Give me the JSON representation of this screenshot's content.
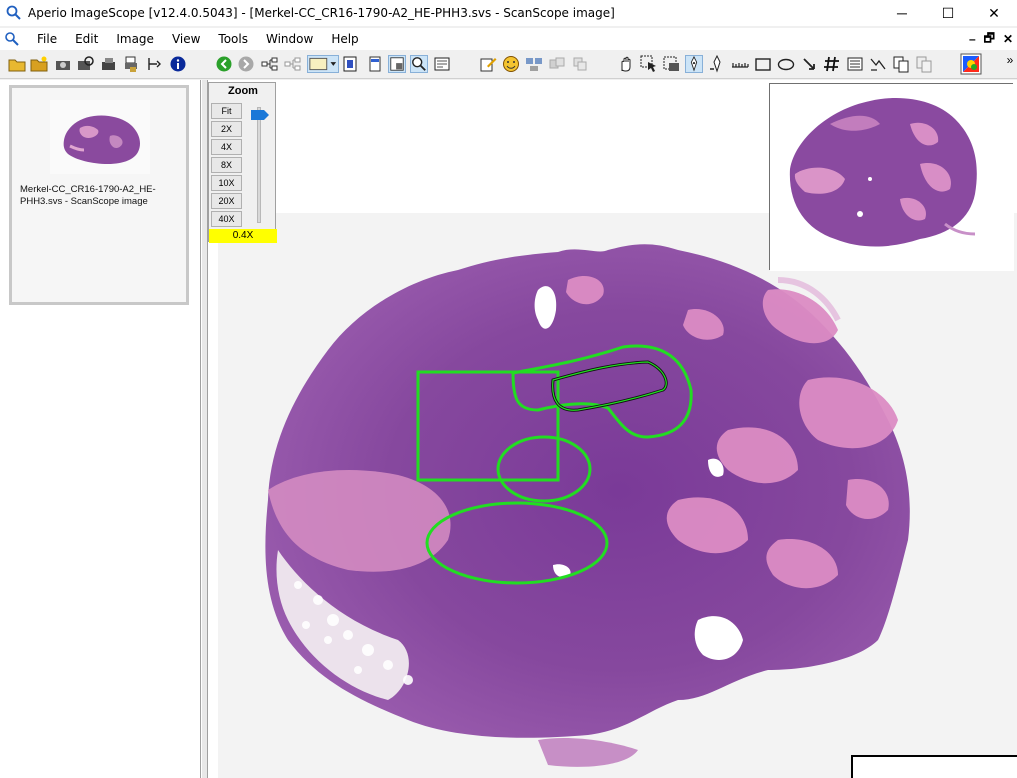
{
  "window": {
    "title": "Aperio ImageScope [v12.4.0.5043] - [Merkel-CC_CR16-1790-A2_HE-PHH3.svs - ScanScope image]",
    "minimize": "─",
    "maximize": "☐",
    "close": "✕"
  },
  "menu": {
    "items": [
      "File",
      "Edit",
      "Image",
      "View",
      "Tools",
      "Window",
      "Help"
    ],
    "mdi_minimize": "–",
    "mdi_restore": "🗗",
    "mdi_close": "✕"
  },
  "images_panel": {
    "items": [
      {
        "label": "Merkel-CC_CR16-1790-A2_HE-PHH3.svs - ScanScope image"
      }
    ]
  },
  "zoom": {
    "title": "Zoom",
    "buttons": [
      "Fit",
      "2X",
      "4X",
      "8X",
      "10X",
      "20X",
      "40X"
    ],
    "current": "0.4X"
  },
  "toolbar": {
    "chevron": "»"
  },
  "colors": {
    "annotation": "#22dd22",
    "tissue_dark": "#7b3f94",
    "tissue_light": "#d98fc4",
    "zoom_highlight": "#ffff00"
  }
}
